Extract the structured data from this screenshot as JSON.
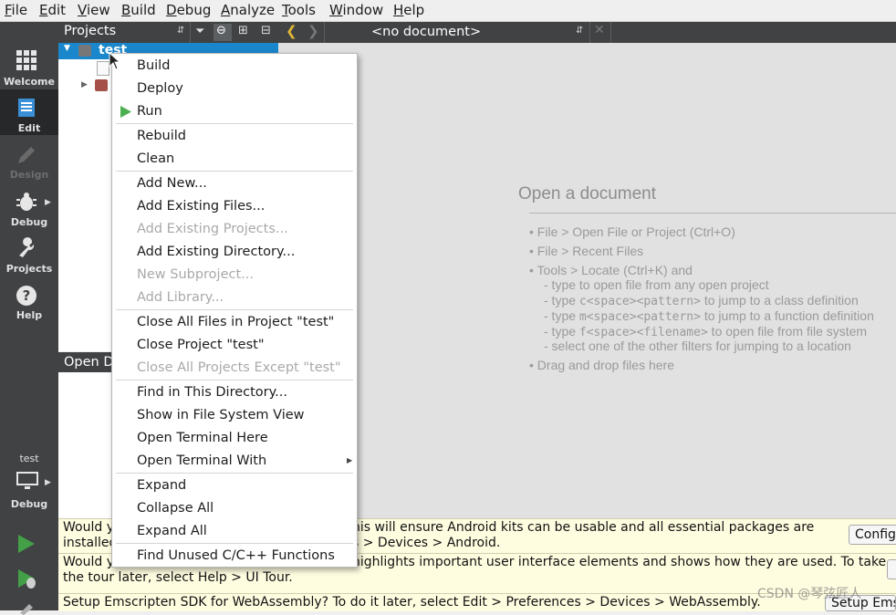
{
  "menubar": [
    "File",
    "Edit",
    "View",
    "Build",
    "Debug",
    "Analyze",
    "Tools",
    "Window",
    "Help"
  ],
  "modes": {
    "welcome": "Welcome",
    "edit": "Edit",
    "design": "Design",
    "debug": "Debug",
    "projects": "Projects",
    "help": "Help"
  },
  "kit": {
    "project": "test",
    "config": "Debug"
  },
  "projects_pane": {
    "title": "Projects",
    "root_item": "test"
  },
  "open_documents": {
    "title": "Open D"
  },
  "editor": {
    "doc_selector": "<no document>",
    "title": "Open a document",
    "hints": [
      "• File > Open File or Project (Ctrl+O)",
      "• File > Recent Files",
      "• Tools > Locate (Ctrl+K) and"
    ],
    "sub1": "- type to open file from any open project",
    "sub2_a": "- type ",
    "sub2_code": "c<space><pattern>",
    "sub2_b": " to jump to a class definition",
    "sub3_a": "- type ",
    "sub3_code": "m<space><pattern>",
    "sub3_b": " to jump to a function definition",
    "sub4_a": "- type ",
    "sub4_code": "f<space><filename>",
    "sub4_b": " to open file from file system",
    "sub5": "- select one of the other filters for jumping to a location",
    "drag": "• Drag and drop files here"
  },
  "context_menu": {
    "build": "Build",
    "deploy": "Deploy",
    "run": "Run",
    "rebuild": "Rebuild",
    "clean": "Clean",
    "add_new": "Add New...",
    "add_existing_files": "Add Existing Files...",
    "add_existing_projects": "Add Existing Projects...",
    "add_existing_directory": "Add Existing Directory...",
    "new_subproject": "New Subproject...",
    "add_library": "Add Library...",
    "close_all_files": "Close All Files in Project \"test\"",
    "close_project": "Close Project \"test\"",
    "close_all_except": "Close All Projects Except \"test\"",
    "find_in_directory": "Find in This Directory...",
    "show_in_fs": "Show in File System View",
    "open_terminal_here": "Open Terminal Here",
    "open_terminal_with": "Open Terminal With",
    "expand": "Expand",
    "collapse_all": "Collapse All",
    "expand_all": "Expand All",
    "find_unused": "Find Unused C/C++ Functions"
  },
  "infobars": {
    "android_l1a": "Would y",
    "android_l1b": "his will ensure Android kits can be usable and all essential packages are",
    "android_l2a": "installed",
    "android_l2b": "s > Devices > Android.",
    "android_button": "Config",
    "tour_l1a": "Would y",
    "tour_l1b": "highlights important user interface elements and shows how they are used. To take",
    "tour_l2": "the tour later, select Help > UI Tour.",
    "wasm_text": "Setup Emscripten SDK for WebAssembly? To do it later, select Edit > Preferences > Devices > WebAssembly.",
    "wasm_button": "Setup Ems",
    "watermark": "CSDN @琴弦匠人"
  },
  "colors": {
    "accent": "#1a86cb",
    "run_green": "#4caf50",
    "sidebar": "#404244"
  }
}
